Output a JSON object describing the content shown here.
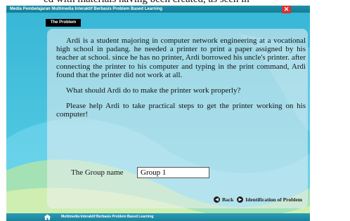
{
  "page_caption_fragment": "ed with materials having been created, as seen in",
  "window": {
    "title": "Media Pembelajaran Multimedia Interaktif Berbasis Problem Based Learning",
    "close_glyph": "✕"
  },
  "section": {
    "tab_label": "The Problem"
  },
  "story": {
    "paragraphs": [
      "Ardi is a student majoring in computer network engineering at a vocational high school in padang. he needed a printer to print a paper assigned by his teacher at school. since he has no printer, Ardi borrowed his uncle's printer. after connecting the printer to his computer and typing in the print command, Ardi found that the printer did not work at all.",
      "What should Ardi do to make the printer work properly?",
      "Please help Ardi to take practical steps to get the printer working on his computer!"
    ]
  },
  "form": {
    "group_label": "The Group name",
    "group_value": "Group 1"
  },
  "navigation": {
    "back_label": "Back",
    "next_label": "Identification of Problem",
    "back_icon": "left-arrow-circle-icon",
    "next_icon": "right-arrow-circle-icon"
  },
  "footer": {
    "text": "Multimedia Interaktif Berbasis Problem Based Learning",
    "icon": "home-icon"
  },
  "colors": {
    "background": "#43bfdc",
    "bar": "#1d8fa9",
    "close": "#d9332f",
    "tab": "#000000"
  }
}
